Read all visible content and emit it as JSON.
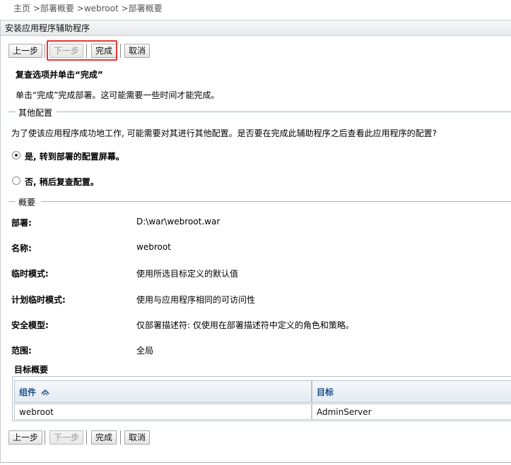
{
  "breadcrumb": {
    "home": "主页",
    "sep1": ">",
    "item1": "部署概要",
    "sep2": ">",
    "item2": "webroot",
    "sep3": ">",
    "item3": "部署概要"
  },
  "panel": {
    "title": "安装应用程序辅助程序"
  },
  "toolbar": {
    "prev_label": "上一步",
    "next_label": "下一步",
    "finish_label": "完成",
    "cancel_label": "取消"
  },
  "review": {
    "heading": "复查选项并单击“完成”",
    "text": "单击“完成”完成部署。这可能需要一些时间才能完成。"
  },
  "other_config": {
    "legend": "其他配置",
    "question": "为了使该应用程序成功地工作, 可能需要对其进行其他配置。是否要在完成此辅助程序之后查看此应用程序的配置?",
    "option_yes": "是, 转到部署的配置屏幕。",
    "option_no": "否, 稍后复查配置。",
    "selected": "yes"
  },
  "summary": {
    "legend": "概要",
    "rows": [
      {
        "label": "部署:",
        "value": "D:\\war\\webroot.war"
      },
      {
        "label": "名称:",
        "value": "webroot"
      },
      {
        "label": "临时模式:",
        "value": "使用所选目标定义的默认值"
      },
      {
        "label": "计划临时模式:",
        "value": "使用与应用程序相同的可访问性"
      },
      {
        "label": "安全模型:",
        "value": "仅部署描述符: 仅使用在部署描述符中定义的角色和策略。"
      },
      {
        "label": "范围:",
        "value": "全局"
      }
    ]
  },
  "target_summary": {
    "title": "目标概要",
    "columns": [
      "组件",
      "目标"
    ],
    "sort_icon": "sort-ascending-icon",
    "rows": [
      {
        "component": "webroot",
        "target": "AdminServer"
      }
    ]
  },
  "colors": {
    "highlight": "#e53935",
    "link_header": "#1a4e8a",
    "section_line": "#99b6d6"
  }
}
